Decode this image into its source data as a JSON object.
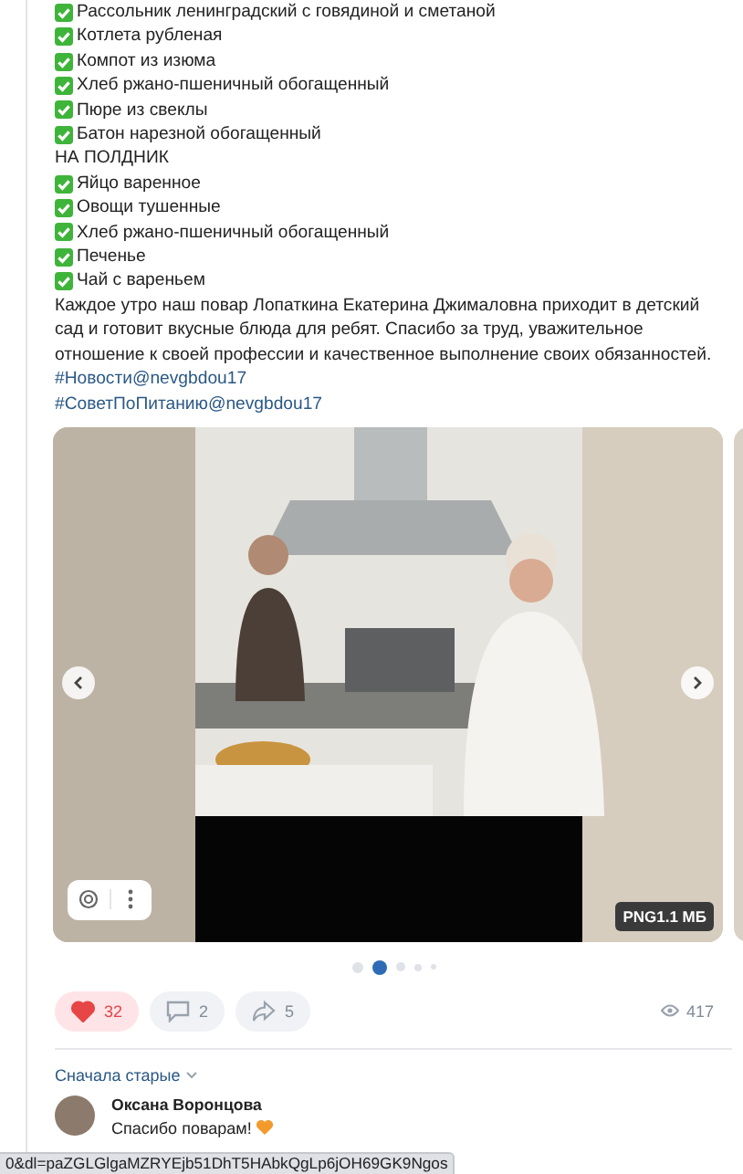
{
  "post": {
    "lines": [
      {
        "kind": "item",
        "text": "Рассольник ленинградский с говядиной и сметаной"
      },
      {
        "kind": "item",
        "text": "Котлета рубленая"
      },
      {
        "kind": "item",
        "text": "Компот из изюма"
      },
      {
        "kind": "item",
        "text": "Хлеб ржано-пшеничный обогащенный"
      },
      {
        "kind": "item",
        "text": "Пюре из свеклы"
      },
      {
        "kind": "item",
        "text": "Батон нарезной обогащенный"
      },
      {
        "kind": "heading",
        "text": "НА ПОЛДНИК"
      },
      {
        "kind": "item",
        "text": "Яйцо варенное"
      },
      {
        "kind": "item",
        "text": "Овощи тушенные"
      },
      {
        "kind": "item",
        "text": "Хлеб ржано-пшеничный обогащенный"
      },
      {
        "kind": "item",
        "text": "Печенье"
      },
      {
        "kind": "item",
        "text": "Чай с вареньем"
      }
    ],
    "paragraph": "Каждое утро наш повар Лопаткина Екатерина Джималовна приходит в детский сад и готовит вкусные блюда для ребят. Спасибо за труд, уважительное отношение к своей профессии и качественное выполнение своих обязанностей.",
    "hashtags": [
      "#Новости@nevgbdou17",
      "#СоветПоПитанию@nevgbdou17"
    ]
  },
  "carousel": {
    "badge": "PNG1.1 МБ",
    "pages": [
      {
        "selected": false
      },
      {
        "selected": true
      },
      {
        "selected": false
      },
      {
        "selected": false
      },
      {
        "selected": false
      }
    ]
  },
  "actions": {
    "likes": {
      "count": "32",
      "liked": true
    },
    "comments": "2",
    "shares": "5",
    "views": "417"
  },
  "comments": {
    "sort": "Сначала старые",
    "items": [
      {
        "author": "Оксана Воронцова",
        "text": "Спасибо поварам!"
      }
    ]
  },
  "status_url": "0&dl=paZGLGlgaMZRYEjb51DhT5HAbkQgLp6jOH69GK9Ngos"
}
